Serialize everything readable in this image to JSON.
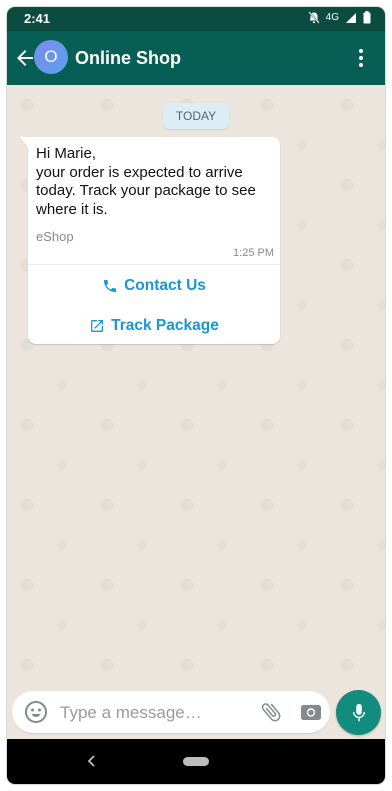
{
  "status_bar": {
    "time": "2:41",
    "network": "4G"
  },
  "header": {
    "avatar_letter": "O",
    "title": "Online Shop"
  },
  "chat": {
    "date_chip": "TODAY",
    "message": {
      "text_lines": [
        "Hi Marie,",
        "your order is expected to arrive today. Track your package to see where it is."
      ],
      "footer": "eShop",
      "time": "1:25 PM",
      "buttons": [
        {
          "label": "Contact Us",
          "icon": "phone-icon"
        },
        {
          "label": "Track Package",
          "icon": "external-link-icon"
        }
      ]
    }
  },
  "composer": {
    "placeholder": "Type a message…"
  },
  "colors": {
    "header": "#075e54",
    "status_bar": "#0b4b40",
    "accent": "#1a96d6",
    "mic": "#128c7e"
  }
}
